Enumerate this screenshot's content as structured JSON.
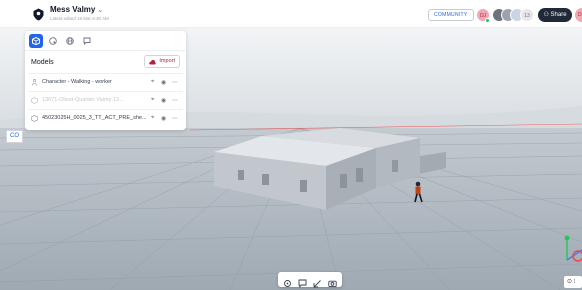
{
  "header": {
    "project_title": "Mess Valmy",
    "title_chevron": "⌄",
    "last_edited": "Latest edited 19 Mar 6:30 AM",
    "community_label": "COMMUNITY",
    "collaborators": [
      "DJ",
      "",
      "",
      ""
    ],
    "collaborator_overflow": "13",
    "share_label": "Share",
    "share_icon": "person-icon",
    "edge_avatar": "DJ"
  },
  "panel": {
    "tabs": [
      "models-tab",
      "materials-tab",
      "environment-tab",
      "comments-tab"
    ],
    "active_tab": 0,
    "title": "Models",
    "import_label": "Import",
    "rows": [
      {
        "label": "Character - Walking - worker",
        "icon": "character-icon",
        "dim": false
      },
      {
        "label": "13671-Olivet-Quartier Valmy-12...",
        "icon": "model-icon",
        "dim": true
      },
      {
        "label": "45023025H_0025_3_TT_ACT_PRE_she...",
        "icon": "model-icon",
        "dim": false
      }
    ],
    "row_actions": [
      "target-icon",
      "eye-icon",
      "more-icon"
    ]
  },
  "viewport": {
    "edge_label": "CO",
    "bottom_tools": [
      "select-tool-icon",
      "comment-tool-icon",
      "measure-tool-icon",
      "camera-tool-icon"
    ],
    "corner_label": "⊙ ⁝",
    "axis_colors": {
      "x": "#ef4444",
      "y": "#22c55e",
      "z": "#3b82f6"
    }
  }
}
